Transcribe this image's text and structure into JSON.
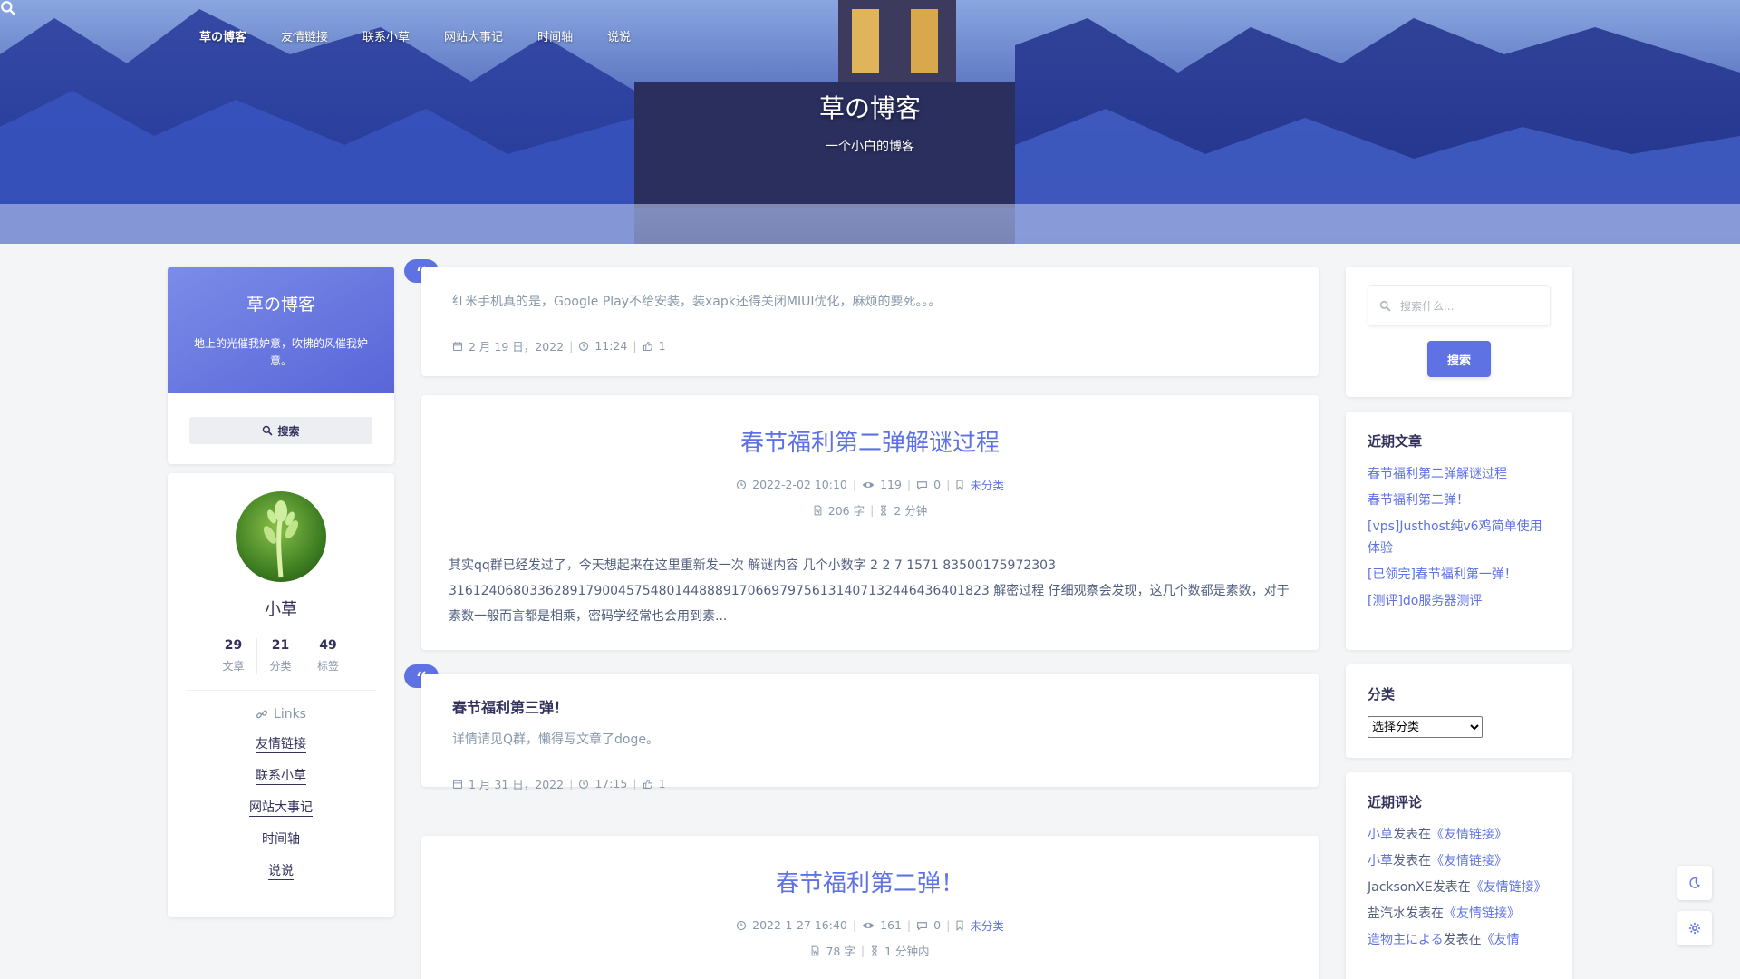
{
  "nav": {
    "items": [
      {
        "label": "草の博客",
        "active": true
      },
      {
        "label": "友情链接"
      },
      {
        "label": "联系小草"
      },
      {
        "label": "网站大事记"
      },
      {
        "label": "时间轴"
      },
      {
        "label": "说说"
      }
    ]
  },
  "hero": {
    "title": "草の博客",
    "subtitle": "一个小白的博客"
  },
  "left": {
    "brand_title": "草の博客",
    "brand_desc": "地上的光催我妒意，吹拂的风催我妒意。",
    "search_label": "搜索",
    "author_name": "小草",
    "stats": [
      {
        "value": "29",
        "label": "文章"
      },
      {
        "value": "21",
        "label": "分类"
      },
      {
        "value": "49",
        "label": "标签"
      }
    ],
    "links_heading": "Links",
    "links": [
      "友情链接",
      "联系小草",
      "网站大事记",
      "时间轴",
      "说说"
    ]
  },
  "posts": {
    "shuoshuo1": {
      "text": "红米手机真的是，Google Play不给安装，装xapk还得关闭MIUI优化，麻烦的要死。。。",
      "date": "2 月 19 日，2022",
      "time": "11:24",
      "likes": "1"
    },
    "article1": {
      "title": "春节福利第二弹解谜过程",
      "date": "2022-2-02 10:10",
      "views": "119",
      "comments": "0",
      "category": "未分类",
      "words": "206 字",
      "read_time": "2 分钟",
      "excerpt": "其实qq群已经发过了，今天想起来在这里重新发一次 解谜内容 几个小数字 2 2 7 1571 83500175972303 316124068033628917900457548014488891706697975613140713244643640182​3 解密过程 仔细观察会发现，这几个数都是素数，对于素数一般而言都是相乘，密码学经常也会用到素..."
    },
    "shuoshuo2": {
      "title": "春节福利第三弹！",
      "text": "详情请见Q群，懒得写文章了doge。",
      "date": "1 月 31 日，2022",
      "time": "17:15",
      "likes": "1"
    },
    "article2": {
      "title": "春节福利第二弹！",
      "date": "2022-1-27 16:40",
      "views": "161",
      "comments": "0",
      "category": "未分类",
      "words": "78 字",
      "read_time": "1 分钟内"
    }
  },
  "right": {
    "search_placeholder": "搜索什么...",
    "search_button": "搜索",
    "recent_heading": "近期文章",
    "recent_posts": [
      "春节福利第二弹解谜过程",
      "春节福利第二弹！",
      "[vps]Justhost纯v6鸡简单使用体验",
      "[已领完]春节福利第一弹！",
      "[测评]do服务器测评"
    ],
    "categories_heading": "分类",
    "categories_select": "选择分类",
    "comments_heading": "近期评论",
    "recent_comments": [
      {
        "author": "小草",
        "joiner": "发表在",
        "post": "《友情链接》"
      },
      {
        "author": "小草",
        "joiner": "发表在",
        "post": "《友情链接》"
      },
      {
        "author": "JacksonXE",
        "joiner": "发表在",
        "post": "《友情链接》"
      },
      {
        "author": "盐汽水",
        "joiner": "发表在",
        "post": "《友情链接》"
      },
      {
        "author": "造物主による",
        "joiner": "发表在",
        "post": "《友情"
      }
    ]
  },
  "icons": {
    "search": "search-icon",
    "calendar": "calendar-icon",
    "clock": "clock-icon",
    "like": "thumbs-up-icon",
    "eye": "eye-icon",
    "comment": "comment-icon",
    "bookmark": "bookmark-icon",
    "file": "file-word-icon",
    "hourglass": "hourglass-icon",
    "link": "link-icon",
    "moon": "moon-icon",
    "gear": "gear-icon",
    "quote": "quote-icon"
  },
  "colors": {
    "accent": "#5e72e4",
    "heading": "#32325d",
    "muted": "#8898aa",
    "background": "#f4f5f7"
  }
}
